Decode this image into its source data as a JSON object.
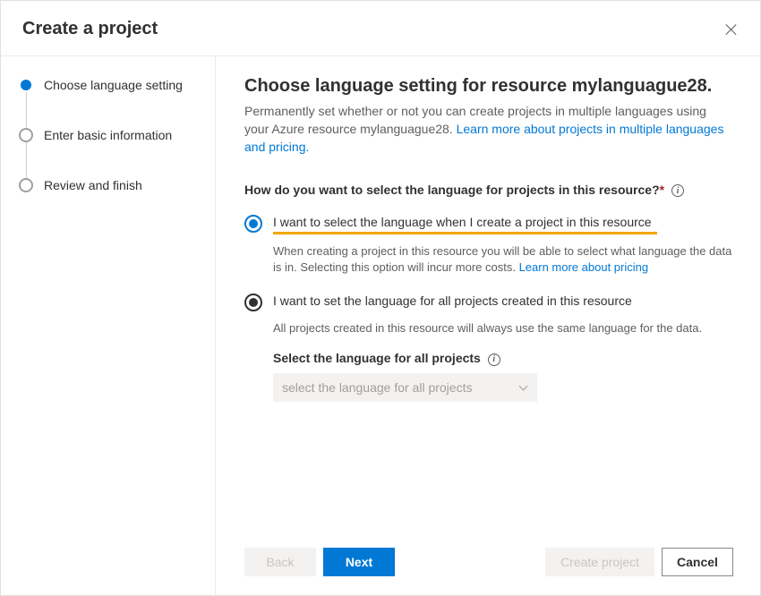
{
  "header": {
    "title": "Create a project"
  },
  "sidebar": {
    "steps": [
      {
        "label": "Choose language setting",
        "active": true
      },
      {
        "label": "Enter basic information",
        "active": false
      },
      {
        "label": "Review and finish",
        "active": false
      }
    ]
  },
  "main": {
    "title": "Choose language setting for resource mylanguague28.",
    "intro_text": "Permanently set whether or not you can create projects in multiple languages using your Azure resource mylanguague28. ",
    "intro_link": "Learn more about projects in multiple languages and pricing.",
    "question": "How do you want to select the language for projects in this resource?",
    "option1": {
      "label": "I want to select the language when I create a project in this resource",
      "desc_pre": "When creating a project in this resource you will be able to select what language the data is in. Selecting this option will incur more costs. ",
      "desc_link": "Learn more about pricing"
    },
    "option2": {
      "label": "I want to set the language for all projects created in this resource",
      "desc": "All projects created in this resource will always use the same language for the data.",
      "sub_label": "Select the language for all projects",
      "dropdown_placeholder": "select the language for all projects"
    }
  },
  "footer": {
    "back": "Back",
    "next": "Next",
    "create": "Create project",
    "cancel": "Cancel"
  }
}
